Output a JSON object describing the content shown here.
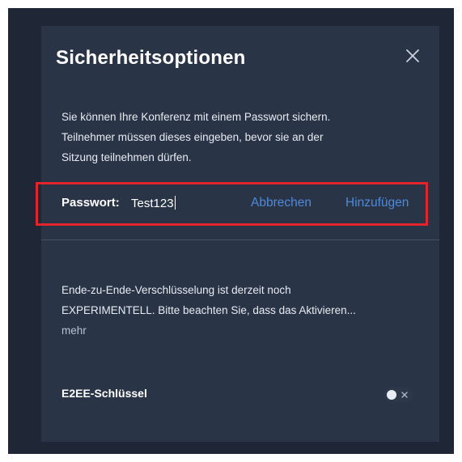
{
  "dialog": {
    "title": "Sicherheitsoptionen",
    "description_lines": [
      "Sie können Ihre Konferenz mit einem Passwort sichern.",
      "Teilnehmer müssen dieses eingeben, bevor sie an der",
      "Sitzung teilnehmen dürfen."
    ]
  },
  "password": {
    "label": "Passwort:",
    "value": "Test123",
    "cancel_label": "Abbrechen",
    "add_label": "Hinzufügen"
  },
  "e2ee": {
    "text_lines": [
      "Ende-zu-Ende-Verschlüsselung ist derzeit noch",
      "EXPERIMENTELL. Bitte beachten Sie, dass das Aktivieren..."
    ],
    "more_label": "mehr",
    "key_label": "E2EE-Schlüssel",
    "key_enabled": false
  },
  "colors": {
    "dialog_bg": "#2a3447",
    "backdrop": "#1f2736",
    "link": "#4f8ad8",
    "highlight": "#e2242c"
  },
  "icons": {
    "close": "close-icon",
    "toggle_off": "x-icon"
  }
}
